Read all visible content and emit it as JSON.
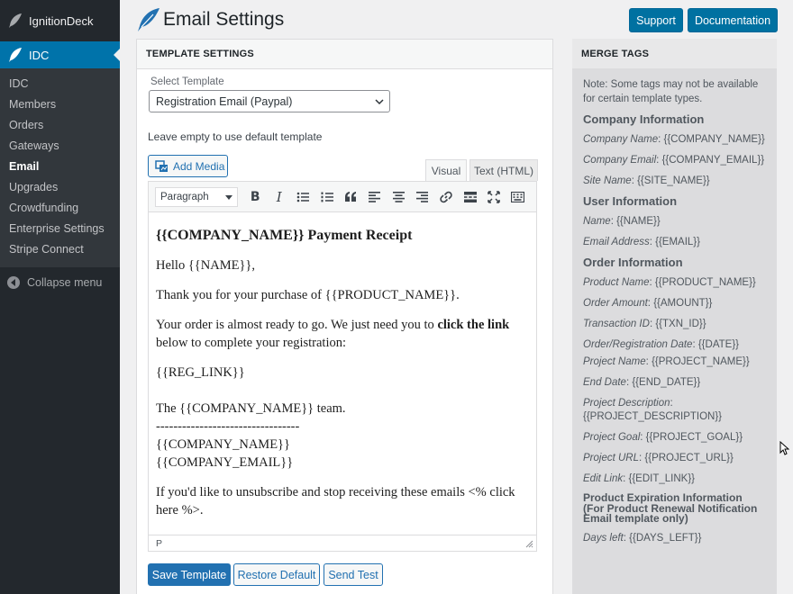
{
  "sidebar": {
    "top_item": "IgnitionDeck",
    "active_item": "IDC",
    "sub_items": [
      "IDC",
      "Members",
      "Orders",
      "Gateways",
      "Email",
      "Upgrades",
      "Crowdfunding",
      "Enterprise Settings",
      "Stripe Connect"
    ],
    "current_sub": "Email",
    "collapse": "Collapse menu"
  },
  "header": {
    "title": "Email Settings",
    "support": "Support",
    "documentation": "Documentation"
  },
  "template": {
    "heading": "TEMPLATE SETTINGS",
    "select_label": "Select Template",
    "select_value": "Registration Email (Paypal)",
    "hint": "Leave empty to use default template",
    "add_media": "Add Media",
    "tab_visual": "Visual",
    "tab_text": "Text (HTML)",
    "format": "Paragraph",
    "content": {
      "heading": "{{COMPANY_NAME}} Payment Receipt",
      "greeting": "Hello {{NAME}},",
      "thanks": "Thank you for your purchase of {{PRODUCT_NAME}}.",
      "ready_before": "Your order is almost ready to go. We just need you to ",
      "ready_bold": "click the link",
      "ready_after": " below to complete your registration:",
      "reg_link": "{{REG_LINK}}",
      "team": "The {{COMPANY_NAME}} team.",
      "divider": "---------------------------------",
      "company_name": "{{COMPANY_NAME}}",
      "company_email": "{{COMPANY_EMAIL}}",
      "unsubscribe": "If you'd like to unsubscribe and stop receiving these emails <% click here %>."
    },
    "status_path": "P",
    "save": "Save Template",
    "restore": "Restore Default",
    "send_test": "Send Test"
  },
  "merge": {
    "heading": "MERGE TAGS",
    "note": "Note: Some tags may not be available for certain template types.",
    "sections": [
      {
        "title": "Company Information",
        "items": [
          {
            "label": "Company Name",
            "tag": "{{COMPANY_NAME}}"
          },
          {
            "label": "Company Email",
            "tag": "{{COMPANY_EMAIL}}"
          },
          {
            "label": "Site Name",
            "tag": "{{SITE_NAME}}"
          }
        ]
      },
      {
        "title": "User Information",
        "items": [
          {
            "label": "Name",
            "tag": "{{NAME}}"
          },
          {
            "label": "Email Address",
            "tag": "{{EMAIL}}"
          }
        ]
      },
      {
        "title": "Order Information",
        "items": [
          {
            "label": "Product Name",
            "tag": "{{PRODUCT_NAME}}"
          },
          {
            "label": "Order Amount",
            "tag": "{{AMOUNT}}"
          },
          {
            "label": "Transaction ID",
            "tag": "{{TXN_ID}}"
          },
          {
            "label": "Order/Registration Date",
            "tag": "{{DATE}}"
          },
          {
            "label": "Project Name",
            "tag": "{{PROJECT_NAME}}"
          },
          {
            "label": "End Date",
            "tag": "{{END_DATE}}"
          },
          {
            "label": "Project Description",
            "tag": "{{PROJECT_DESCRIPTION}}"
          },
          {
            "label": "Project Goal",
            "tag": "{{PROJECT_GOAL}}"
          },
          {
            "label": "Project URL",
            "tag": "{{PROJECT_URL}}"
          },
          {
            "label": "Edit Link",
            "tag": "{{EDIT_LINK}}"
          }
        ]
      },
      {
        "title": "Product Expiration Information (For Product Renewal Notification Email template only)",
        "items": [
          {
            "label": "Days left",
            "tag": "{{DAYS_LEFT}}"
          }
        ]
      }
    ]
  },
  "colors": {
    "sidebar": "#23282d",
    "accent": "#0073aa",
    "button": "#2271b1"
  }
}
